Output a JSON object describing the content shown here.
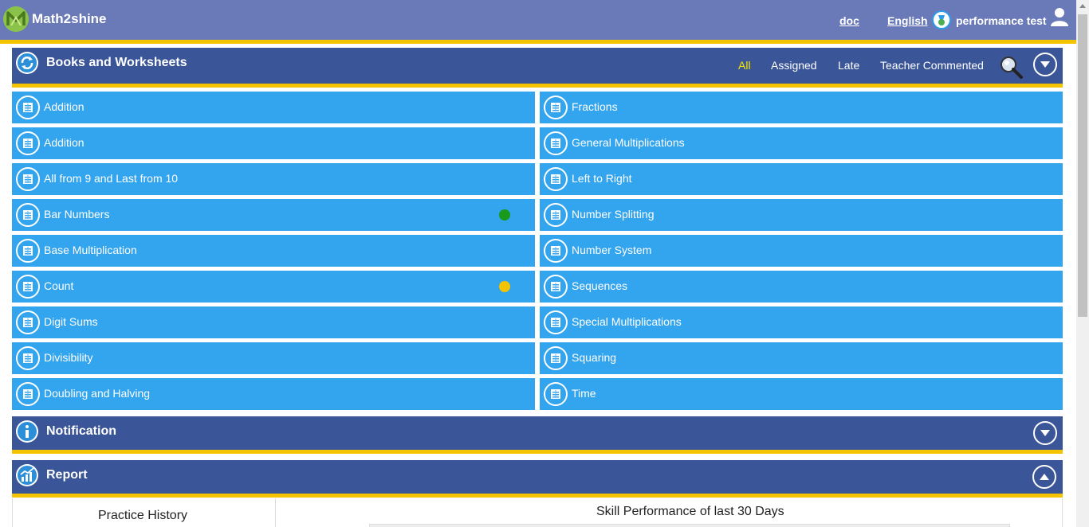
{
  "app": {
    "brand": "Math2shine",
    "doc_link": "doc",
    "language": "English",
    "user_name": "performance test"
  },
  "books_section": {
    "title": "Books and Worksheets",
    "filters": [
      "All",
      "Assigned",
      "Late",
      "Teacher Commented"
    ],
    "active_filter": "All",
    "left_column": [
      {
        "label": "Addition",
        "status": ""
      },
      {
        "label": "Addition",
        "status": ""
      },
      {
        "label": "All from 9 and Last from 10",
        "status": ""
      },
      {
        "label": "Bar Numbers",
        "status": "green"
      },
      {
        "label": "Base Multiplication",
        "status": ""
      },
      {
        "label": "Count",
        "status": "yellow"
      },
      {
        "label": "Digit Sums",
        "status": ""
      },
      {
        "label": "Divisibility",
        "status": ""
      },
      {
        "label": "Doubling and Halving",
        "status": ""
      }
    ],
    "right_column": [
      {
        "label": "Fractions",
        "status": ""
      },
      {
        "label": "General Multiplications",
        "status": ""
      },
      {
        "label": "Left to Right",
        "status": ""
      },
      {
        "label": "Number Splitting",
        "status": ""
      },
      {
        "label": "Number System",
        "status": ""
      },
      {
        "label": "Sequences",
        "status": ""
      },
      {
        "label": "Special Multiplications",
        "status": ""
      },
      {
        "label": "Squaring",
        "status": ""
      },
      {
        "label": "Time",
        "status": ""
      }
    ]
  },
  "notification_section": {
    "title": "Notification"
  },
  "report_section": {
    "title": "Report",
    "practice_history": "Practice History",
    "skill_performance": "Skill Performance of last 30 Days"
  },
  "colors": {
    "topbar": "#6a79b8",
    "accent_stripe": "#f5c400",
    "section_header": "#3a5598",
    "book_row": "#33a4ee",
    "active_filter": "#f5e500",
    "status_green": "#1a9a1a",
    "status_yellow": "#f5c400"
  }
}
